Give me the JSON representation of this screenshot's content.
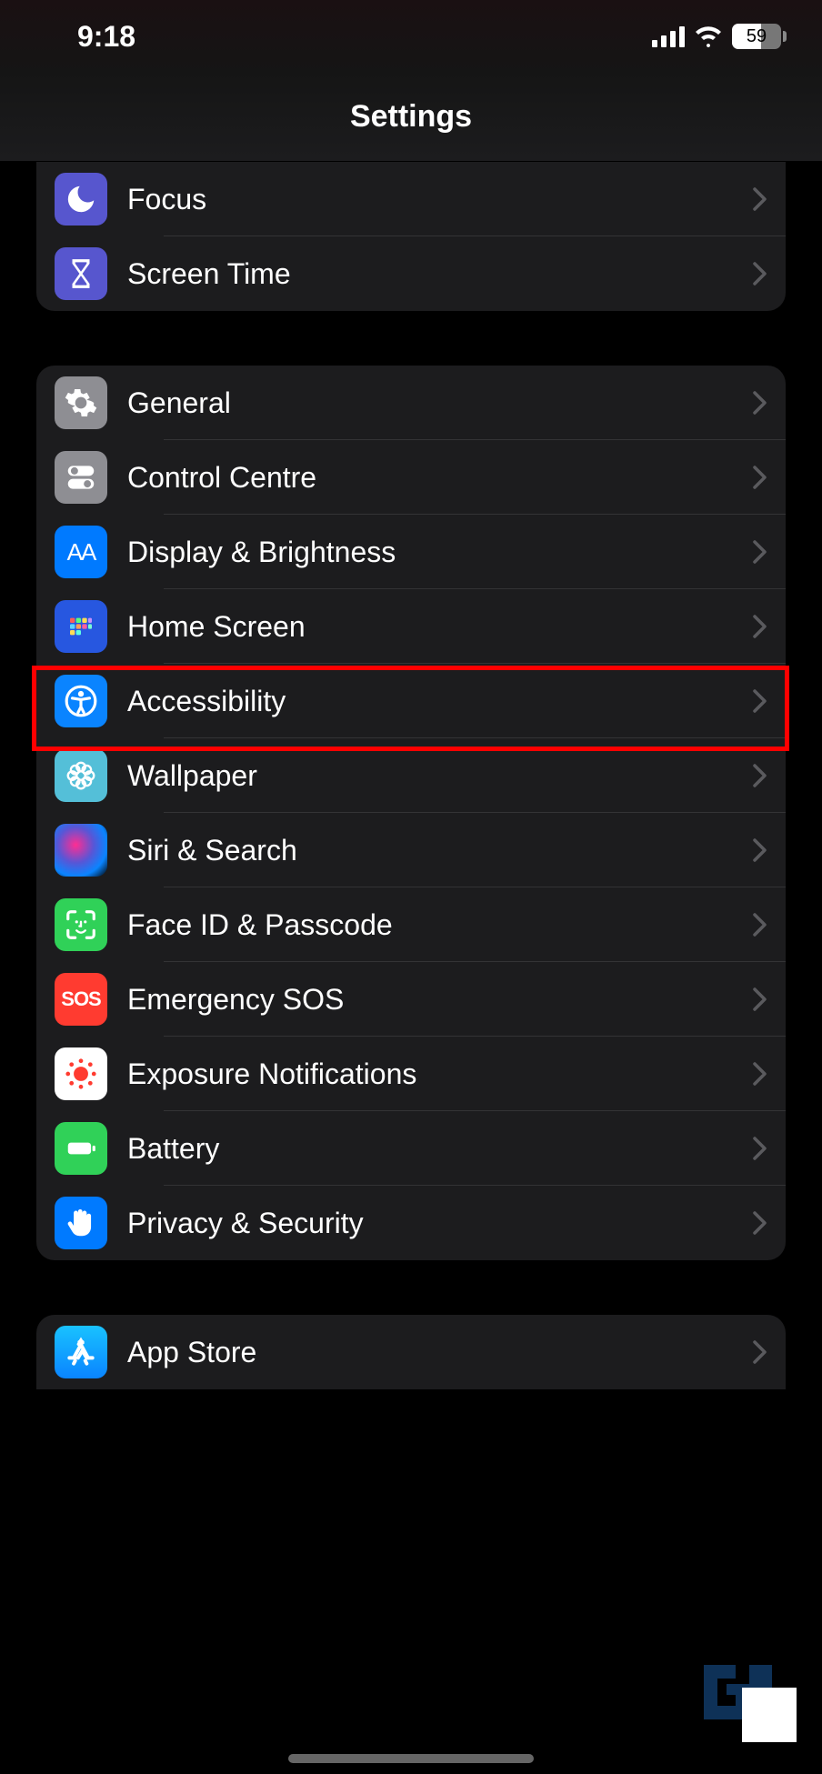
{
  "statusbar": {
    "time": "9:18",
    "battery": "59"
  },
  "navbar": {
    "title": "Settings"
  },
  "group1": {
    "items": [
      {
        "label": "Focus"
      },
      {
        "label": "Screen Time"
      }
    ]
  },
  "group2": {
    "items": [
      {
        "label": "General"
      },
      {
        "label": "Control Centre"
      },
      {
        "label": "Display & Brightness"
      },
      {
        "label": "Home Screen"
      },
      {
        "label": "Accessibility"
      },
      {
        "label": "Wallpaper"
      },
      {
        "label": "Siri & Search"
      },
      {
        "label": "Face ID & Passcode"
      },
      {
        "label": "Emergency SOS"
      },
      {
        "label": "Exposure Notifications"
      },
      {
        "label": "Battery"
      },
      {
        "label": "Privacy & Security"
      }
    ]
  },
  "group3": {
    "items": [
      {
        "label": "App Store"
      }
    ]
  },
  "highlighted": "Accessibility"
}
